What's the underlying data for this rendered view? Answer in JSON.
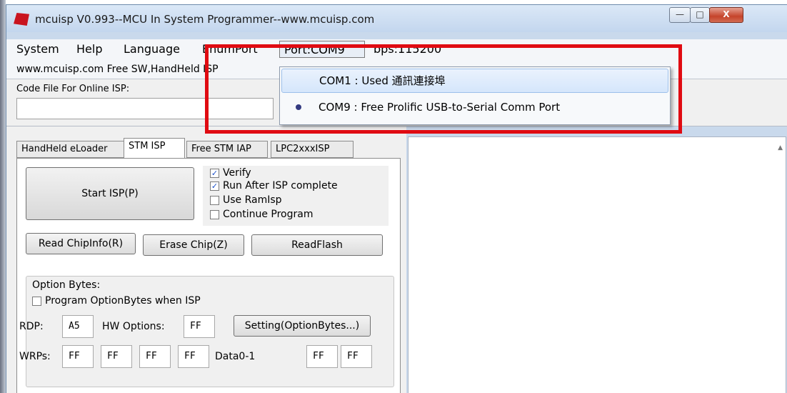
{
  "window": {
    "title": "mcuisp V0.993--MCU In System Programmer--www.mcuisp.com",
    "min": "—",
    "max": "□",
    "close": "X"
  },
  "menu": {
    "system": "System",
    "help": "Help",
    "language": "Language",
    "enumport": "EnumPort",
    "port": "Port:COM9",
    "bps": "bps:115200"
  },
  "info_text": "www.mcuisp.com Free SW,HandHeld ISP",
  "code_file_label": "Code File For Online ISP:",
  "port_dropdown": [
    {
      "label": "COM1 : Used 通訊連接埠",
      "selected": false
    },
    {
      "label": "COM9 : Free Prolific USB-to-Serial Comm Port",
      "selected": true
    }
  ],
  "tabs": [
    "HandHeld eLoader",
    "STM ISP",
    "Free STM IAP",
    "LPC2xxxISP"
  ],
  "start_isp": "Start ISP(P)",
  "checks": {
    "verify": "Verify",
    "run_after": "Run After ISP complete",
    "use_ramisp": "Use RamIsp",
    "continue_program": "Continue Program"
  },
  "buttons": {
    "read_chipinfo": "Read ChipInfo(R)",
    "erase_chip": "Erase Chip(Z)",
    "read_flash": "ReadFlash",
    "setting": "Setting(OptionBytes...)"
  },
  "option_bytes": {
    "label": "Option Bytes:",
    "program_when_isp": "Program OptionBytes when ISP",
    "rdp_label": "RDP:",
    "rdp": "A5",
    "hw_label": "HW Options:",
    "hw": "FF",
    "wrps_label": "WRPs:",
    "wrps": [
      "FF",
      "FF",
      "FF",
      "FF"
    ],
    "data_label": "Data0-1",
    "data": [
      "FF",
      "FF"
    ]
  },
  "check_mark": "✓",
  "scroll_up": "▲"
}
